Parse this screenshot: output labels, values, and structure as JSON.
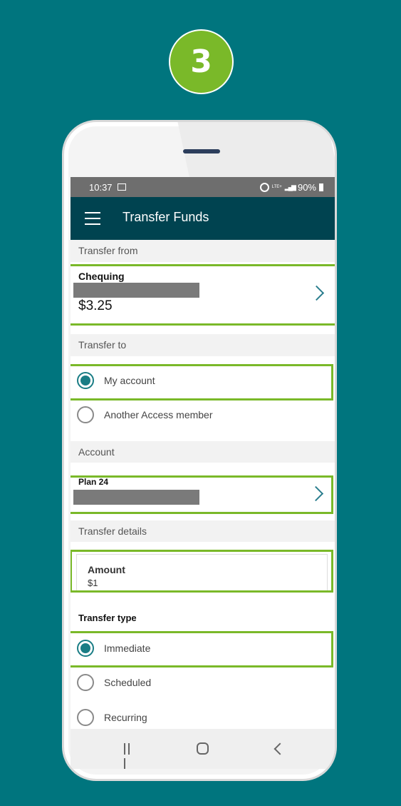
{
  "step": {
    "number": "3"
  },
  "status_bar": {
    "time": "10:37",
    "lte": "LTE+",
    "battery": "90%"
  },
  "app_bar": {
    "title": "Transfer Funds"
  },
  "transfer_from": {
    "header": "Transfer from",
    "account_name": "Chequing",
    "balance": "$3.25"
  },
  "transfer_to": {
    "header": "Transfer to",
    "options": [
      {
        "label": "My account",
        "selected": true
      },
      {
        "label": "Another Access member",
        "selected": false
      }
    ]
  },
  "account": {
    "header": "Account",
    "name": "Plan 24"
  },
  "transfer_details": {
    "header": "Transfer details",
    "amount_label": "Amount",
    "amount_value": "$1"
  },
  "transfer_type": {
    "label": "Transfer type",
    "options": [
      {
        "label": "Immediate",
        "selected": true
      },
      {
        "label": "Scheduled",
        "selected": false
      },
      {
        "label": "Recurring",
        "selected": false
      }
    ]
  },
  "colors": {
    "background": "#00757e",
    "app_bar": "#004350",
    "highlight": "#7ab929",
    "radio_selected": "#1a7d85"
  },
  "icons": {
    "menu": "hamburger-menu-icon",
    "chevron": "chevron-right-icon",
    "nav_recent": "recent-apps-icon",
    "nav_home": "home-icon",
    "nav_back": "back-icon"
  }
}
